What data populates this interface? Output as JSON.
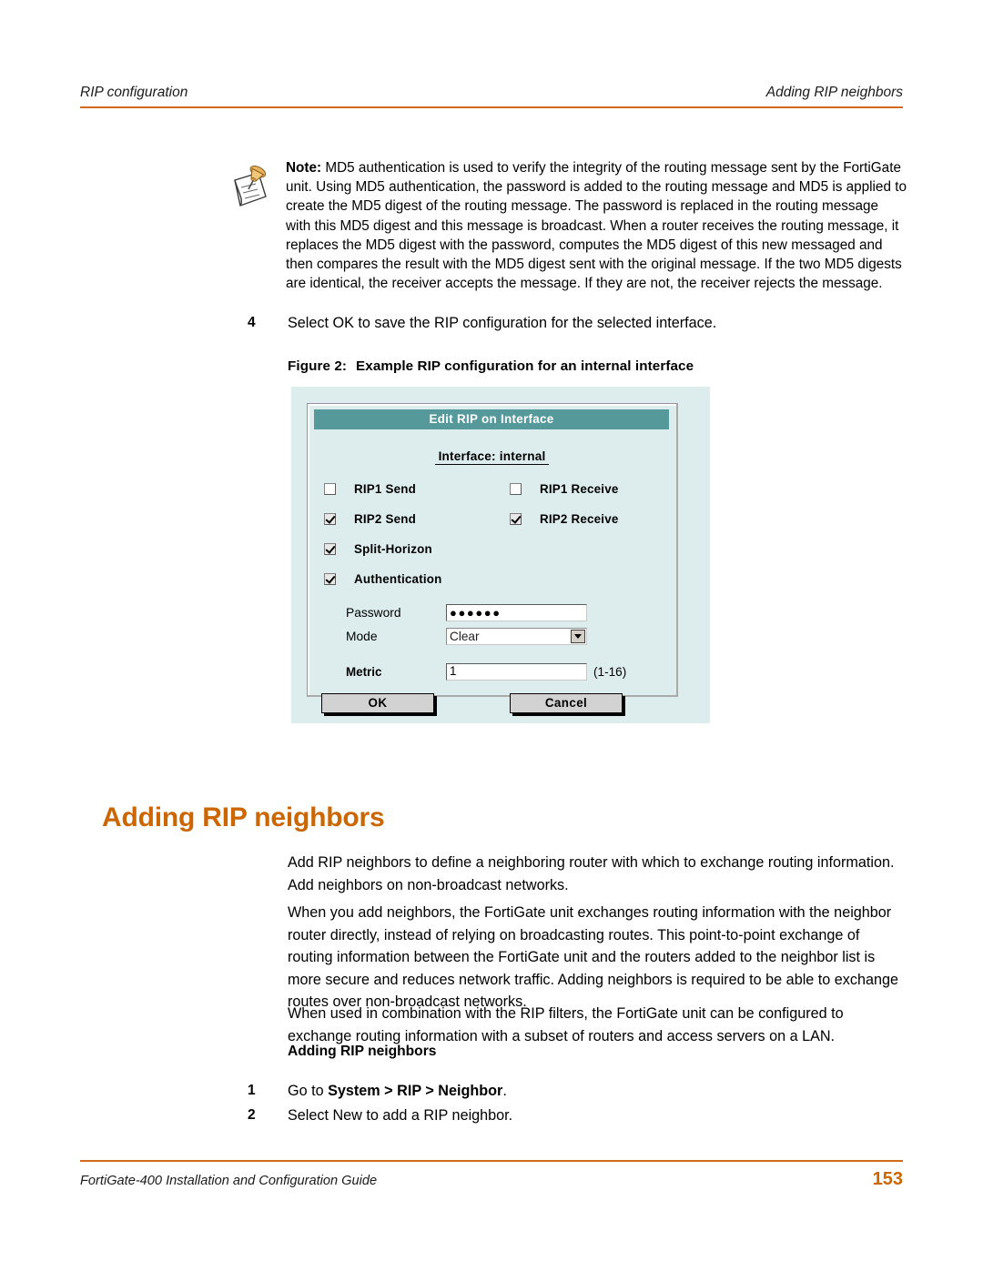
{
  "header": {
    "left": "RIP configuration",
    "right": "Adding RIP neighbors"
  },
  "note": {
    "icon": "note-pushpin-icon",
    "label": "Note:",
    "text": " MD5 authentication is used to verify the integrity of the routing message sent by the FortiGate unit. Using MD5 authentication, the password is added to the routing message and MD5 is applied to create the MD5 digest of the routing message. The password is replaced in the routing message with this MD5 digest and this message is broadcast. When a router receives the routing message, it replaces the MD5 digest with the password, computes the MD5 digest of this new messaged and then compares the result with the MD5 digest sent with the original message. If the two MD5 digests are identical, the receiver accepts the message. If they are not, the receiver rejects the message."
  },
  "steps_top": [
    {
      "num": "4",
      "text": "Select OK to save the RIP configuration for the selected interface."
    }
  ],
  "figure": {
    "caption_label": "Figure 2:",
    "caption_text": "Example RIP configuration for an internal interface",
    "colors": {
      "panel_bg": "#ddeded",
      "titlebar": "#55999b",
      "button_face": "#d2d2d2"
    },
    "dialog": {
      "title": "Edit RIP on Interface",
      "subtitle": "Interface: internal",
      "checkboxes": [
        {
          "label": "RIP1 Send",
          "checked": false
        },
        {
          "label": "RIP1 Receive",
          "checked": false
        },
        {
          "label": "RIP2 Send",
          "checked": true
        },
        {
          "label": "RIP2 Receive",
          "checked": true
        },
        {
          "label": "Split-Horizon",
          "checked": true
        },
        {
          "label": "Authentication",
          "checked": true
        }
      ],
      "fields": {
        "password_label": "Password",
        "password_value": "●●●●●●",
        "mode_label": "Mode",
        "mode_value": "Clear",
        "metric_label": "Metric",
        "metric_value": "1",
        "metric_hint": "(1-16)"
      },
      "buttons": {
        "ok": "OK",
        "cancel": "Cancel"
      }
    }
  },
  "heading": "Adding RIP neighbors",
  "paragraphs": {
    "p1": "Add RIP neighbors to define a neighboring router with which to exchange routing information. Add neighbors on non-broadcast networks.",
    "p2": "When you add neighbors, the FortiGate unit exchanges routing information with the neighbor router directly, instead of relying on broadcasting routes. This point-to-point exchange of routing information between the FortiGate unit and the routers added to the neighbor list is more secure and reduces network traffic. Adding neighbors is required to be able to exchange routes over non-broadcast networks.",
    "p3": "When used in combination with the RIP filters, the FortiGate unit can be configured to exchange routing information with a subset of routers and access servers on a LAN."
  },
  "sub_heading": "Adding RIP neighbors",
  "steps_bottom": [
    {
      "num": "1",
      "prefix": "Go to ",
      "bold": "System > RIP > Neighbor",
      "suffix": "."
    },
    {
      "num": "2",
      "prefix": "Select New to add a RIP neighbor.",
      "bold": "",
      "suffix": ""
    }
  ],
  "footer": {
    "left": "FortiGate-400 Installation and Configuration Guide",
    "page": "153"
  }
}
